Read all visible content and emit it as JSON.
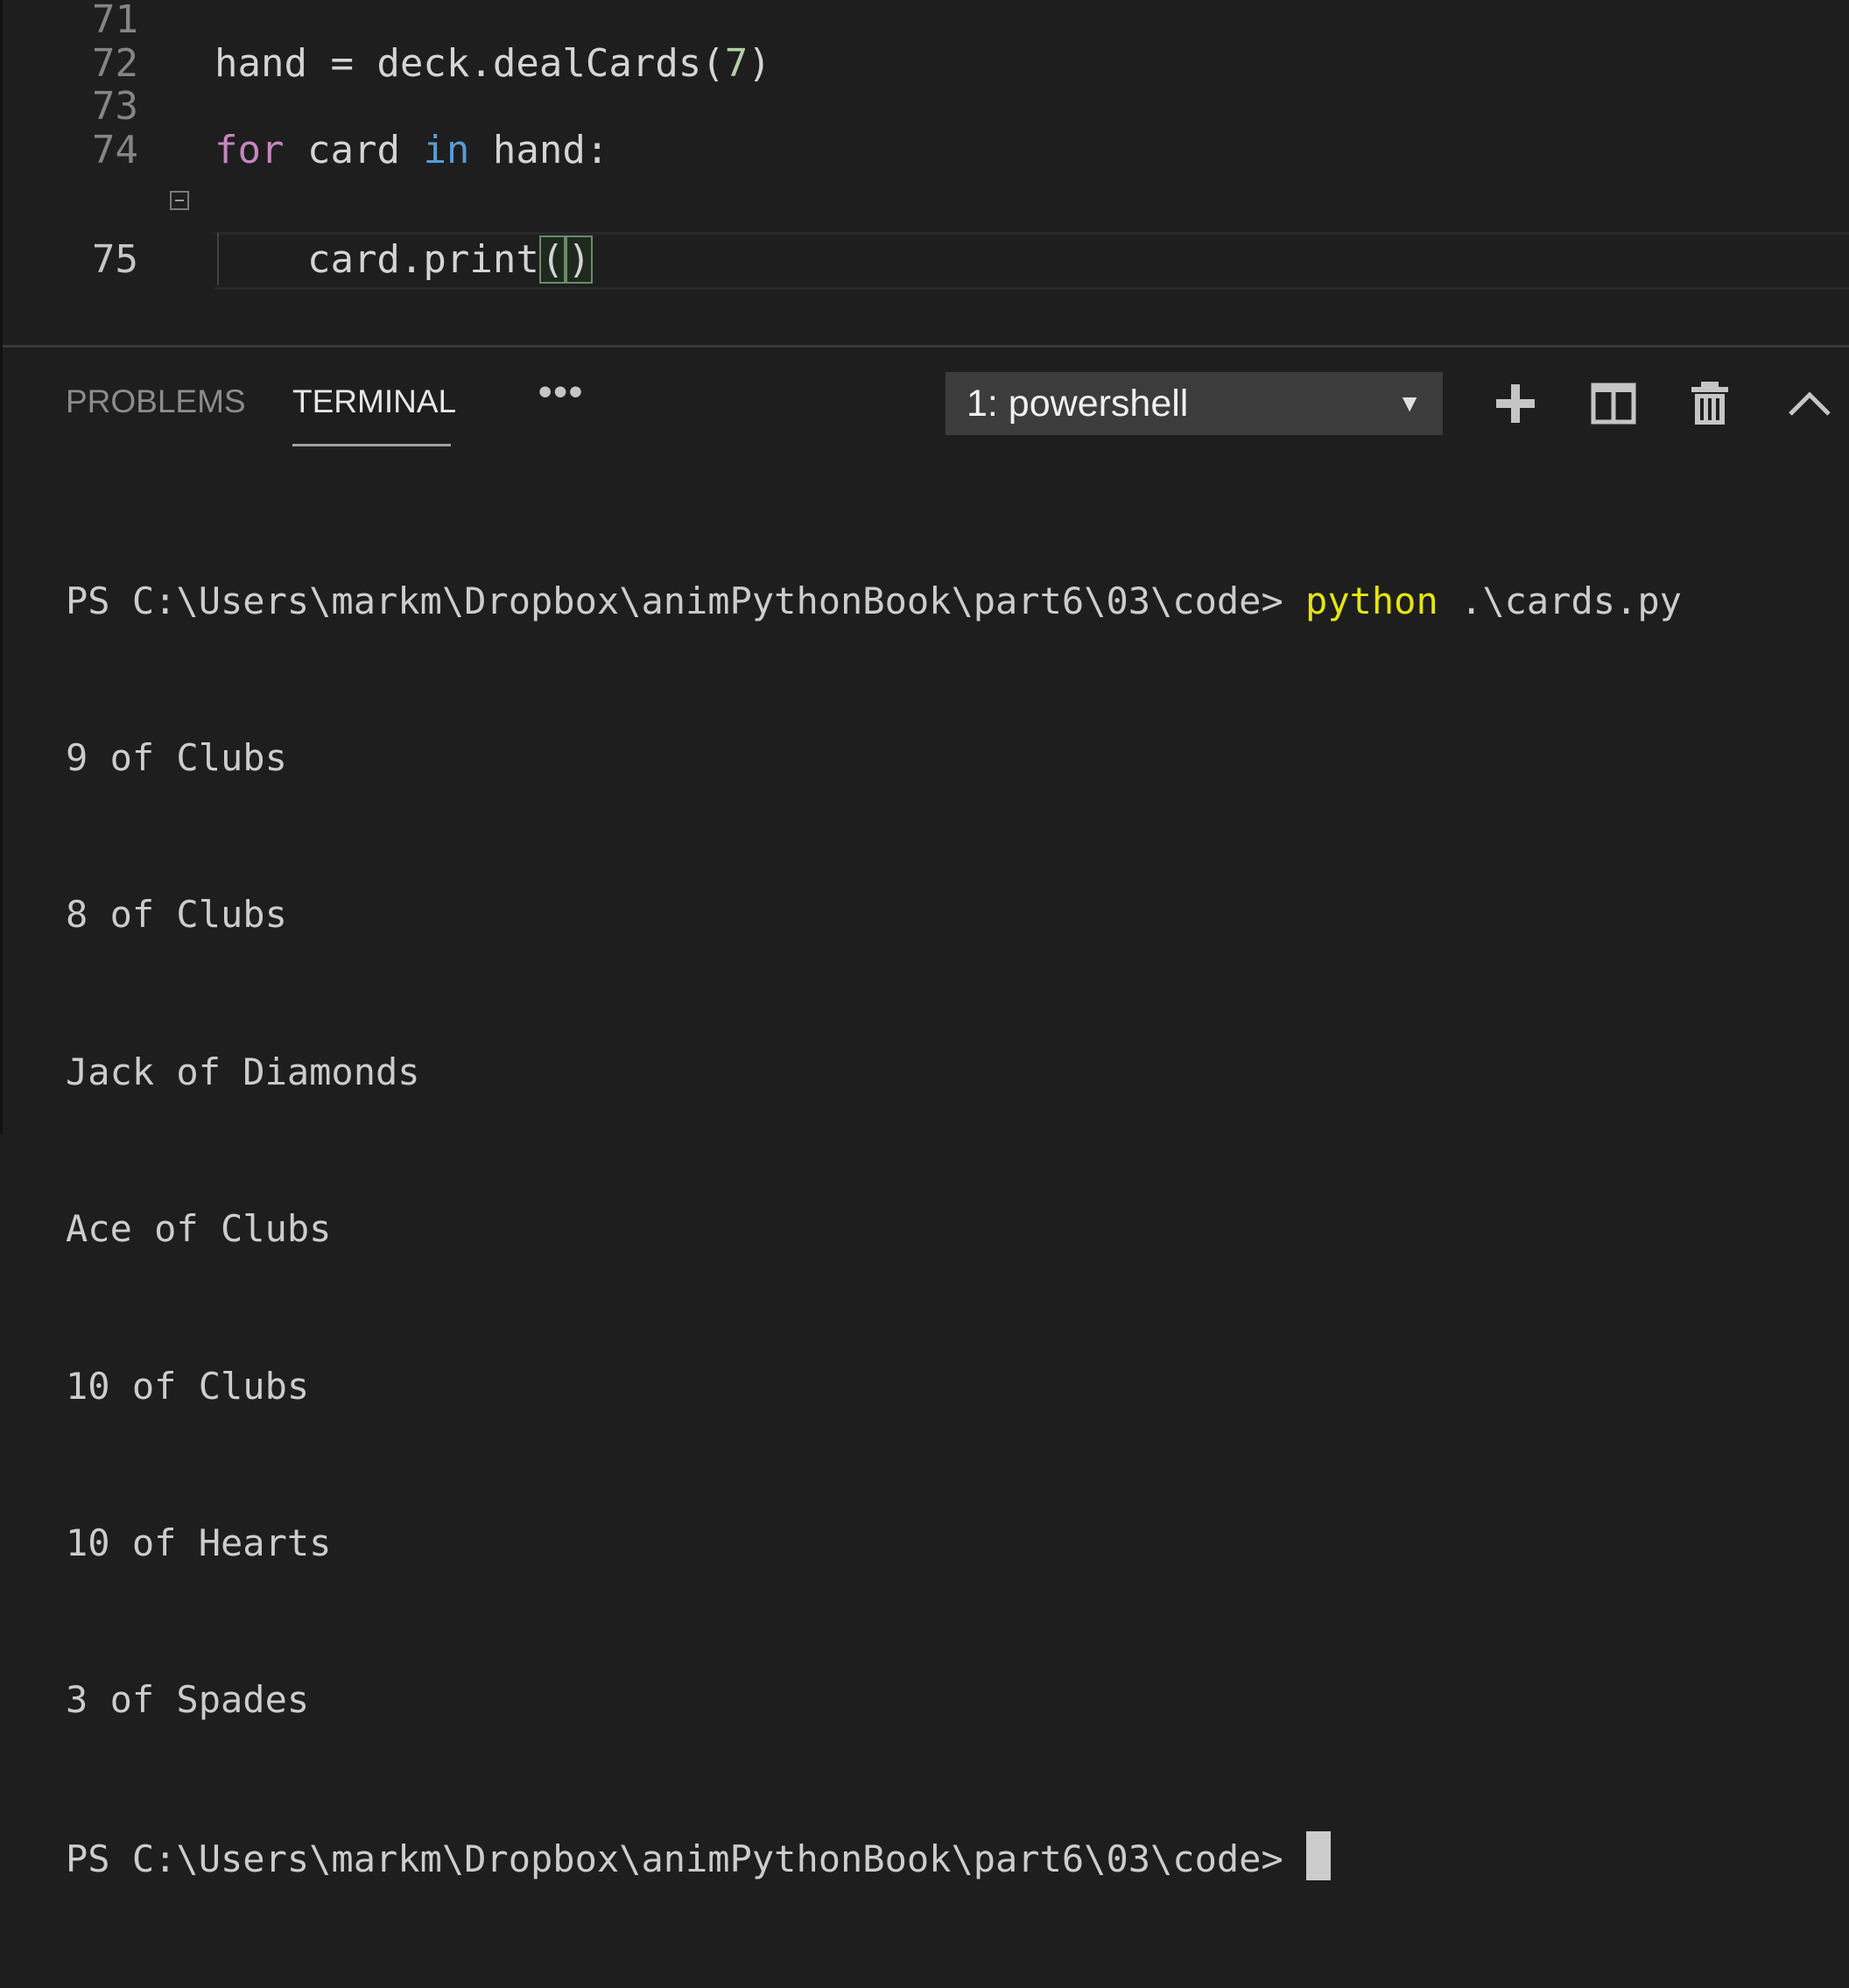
{
  "editor": {
    "lines": [
      {
        "number": "71",
        "segments": []
      },
      {
        "number": "72",
        "segments": [
          {
            "text": "hand = deck.dealCards(",
            "cls": ""
          },
          {
            "text": "7",
            "cls": "num"
          },
          {
            "text": ")",
            "cls": ""
          }
        ]
      },
      {
        "number": "73",
        "segments": []
      },
      {
        "number": "74",
        "segments": [
          {
            "text": "for",
            "cls": "kw-for"
          },
          {
            "text": " card ",
            "cls": ""
          },
          {
            "text": "in",
            "cls": "kw-in"
          },
          {
            "text": " hand:",
            "cls": ""
          }
        ]
      },
      {
        "number": "75",
        "segments": [
          {
            "text": "    card.print",
            "cls": ""
          },
          {
            "text": "(",
            "cls": "paren-match"
          },
          {
            "text": ")",
            "cls": "paren-match"
          }
        ]
      }
    ]
  },
  "panel": {
    "tabs": [
      {
        "label": "PROBLEMS",
        "active": false
      },
      {
        "label": "TERMINAL",
        "active": true
      }
    ],
    "more_label": "•••",
    "terminal_select": {
      "value": "1: powershell",
      "arrow": "▼"
    },
    "toolbar_icons": [
      "plus-icon",
      "split-terminal-icon",
      "trash-icon",
      "chevron-up-icon"
    ]
  },
  "terminal": {
    "prompt": "PS C:\\Users\\markm\\Dropbox\\animPythonBook\\part6\\03\\code> ",
    "command_keyword": "python",
    "command_args": " .\\cards.py",
    "output": [
      "9 of Clubs",
      "8 of Clubs",
      "Jack of Diamonds",
      "Ace of Clubs",
      "10 of Clubs",
      "10 of Hearts",
      "3 of Spades"
    ],
    "final_prompt": "PS C:\\Users\\markm\\Dropbox\\animPythonBook\\part6\\03\\code>"
  }
}
